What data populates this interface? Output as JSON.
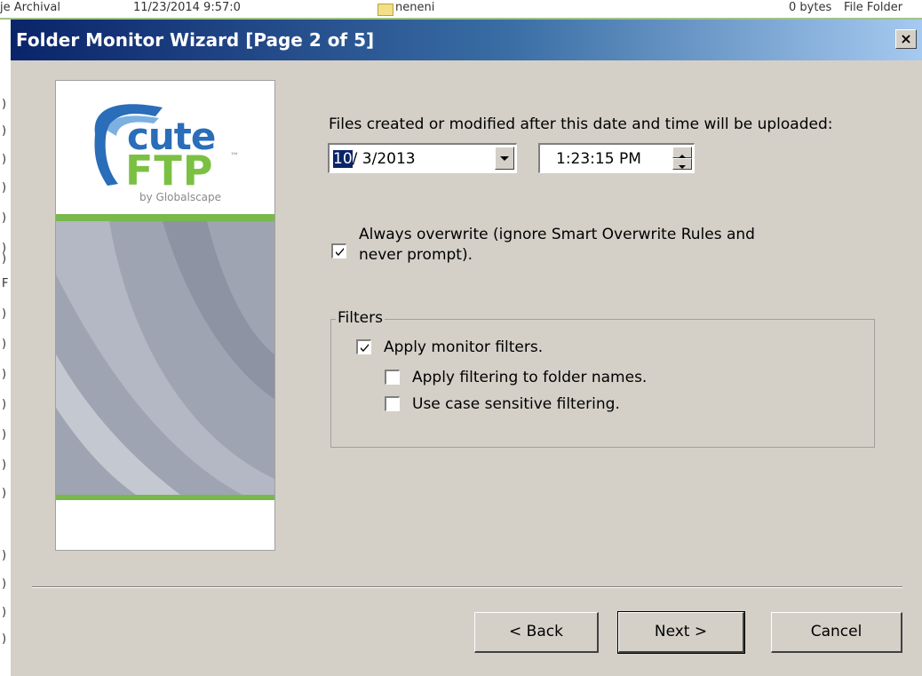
{
  "background": {
    "name_frag": "je Archival",
    "date_frag": "11/23/2014 9:57:0",
    "folder_frag": "neneni",
    "size_frag": "0 bytes",
    "type_frag": "File Folder",
    "gutter_chars": [
      ")",
      ")",
      ")",
      ")",
      ")",
      ")",
      ")",
      "F",
      ")",
      ")",
      ")",
      ")",
      ")",
      ")",
      ")",
      ")",
      ")",
      ")",
      ")"
    ]
  },
  "dialog": {
    "title": "Folder Monitor Wizard [Page 2 of 5]",
    "close_label": "×"
  },
  "logo": {
    "cute": "cute",
    "ftp": "FTP",
    "tm": "™",
    "by": "by Globalscape"
  },
  "content": {
    "date_prompt": "Files created or modified after this date and time will be uploaded:",
    "date_selected_part": "10",
    "date_rest": "/ 3/2013",
    "time_value": "1:23:15 PM",
    "overwrite_line1": "Always overwrite (ignore Smart Overwrite Rules and",
    "overwrite_line2": "never prompt).",
    "overwrite_checked": true
  },
  "filters": {
    "legend": "Filters",
    "apply_monitor": "Apply monitor filters.",
    "apply_monitor_checked": true,
    "apply_folder_names": "Apply filtering to folder names.",
    "apply_folder_names_checked": false,
    "case_sensitive": "Use case sensitive filtering.",
    "case_sensitive_checked": false
  },
  "buttons": {
    "back": "< Back",
    "next": "Next >",
    "cancel": "Cancel"
  },
  "colors": {
    "title_start": "#0a246a",
    "face": "#d4d0c8",
    "brand_blue": "#2a6db8",
    "brand_green": "#7bc043"
  }
}
